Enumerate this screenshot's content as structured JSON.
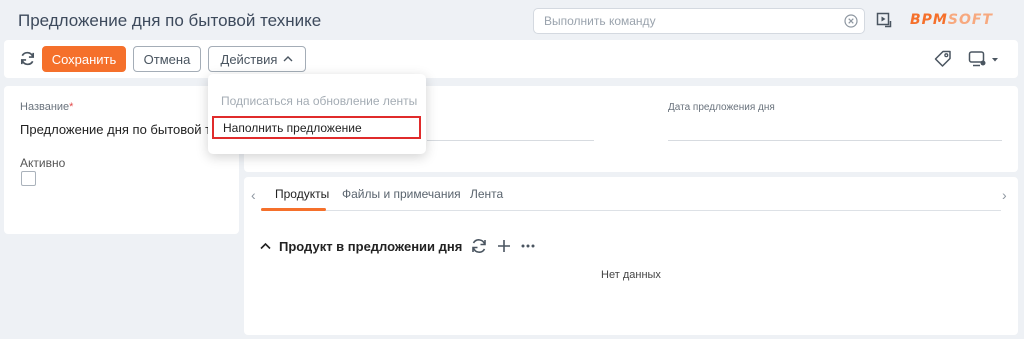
{
  "header": {
    "title": "Предложение дня по бытовой технике",
    "command_placeholder": "Выполнить команду",
    "logo": {
      "part1": "BPM",
      "part2": "SOFT"
    }
  },
  "toolbar": {
    "save_label": "Сохранить",
    "cancel_label": "Отмена",
    "actions_label": "Действия"
  },
  "actions_menu": {
    "items": [
      {
        "label": "Подписаться на обновление ленты",
        "enabled": false
      },
      {
        "label": "Наполнить предложение",
        "enabled": true,
        "highlighted": true
      }
    ]
  },
  "form": {
    "name_label": "Название",
    "name_required_mark": "*",
    "name_value": "Предложение дня по бытовой техн...",
    "active_label": "Активно",
    "active_checked": false,
    "date_label": "Дата предложения дня"
  },
  "tabs": {
    "items": [
      {
        "label": "Продукты",
        "active": true
      },
      {
        "label": "Файлы и примечания",
        "active": false
      },
      {
        "label": "Лента",
        "active": false
      }
    ]
  },
  "detail": {
    "title": "Продукт в предложении дня",
    "empty_text": "Нет данных"
  },
  "colors": {
    "accent": "#f5702b",
    "highlight_border": "#e02b2b",
    "background": "#eef1f5"
  }
}
